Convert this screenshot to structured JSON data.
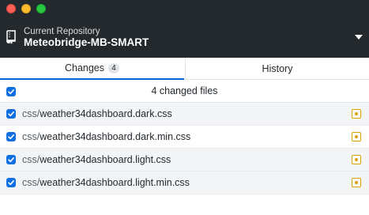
{
  "window": {
    "colors": {
      "titlebar": "#24292e",
      "accent": "#0366d6",
      "modified": "#d9a200"
    }
  },
  "repository": {
    "caption": "Current Repository",
    "name": "Meteobridge-MB-SMART"
  },
  "tabs": [
    {
      "label": "Changes",
      "count": "4",
      "selected": true
    },
    {
      "label": "History",
      "selected": false
    }
  ],
  "changes": {
    "summary": "4 changed files",
    "select_all_checked": true,
    "files": [
      {
        "dir": "css/",
        "name": "weather34dashboard.dark.css",
        "checked": true,
        "status_icon": "modified-icon",
        "selected": true
      },
      {
        "dir": "css/",
        "name": "weather34dashboard.dark.min.css",
        "checked": true,
        "status_icon": "modified-icon",
        "selected": false
      },
      {
        "dir": "css/",
        "name": "weather34dashboard.light.css",
        "checked": true,
        "status_icon": "modified-icon",
        "selected": true
      },
      {
        "dir": "css/",
        "name": "weather34dashboard.light.min.css",
        "checked": true,
        "status_icon": "modified-icon",
        "selected": true
      }
    ]
  }
}
